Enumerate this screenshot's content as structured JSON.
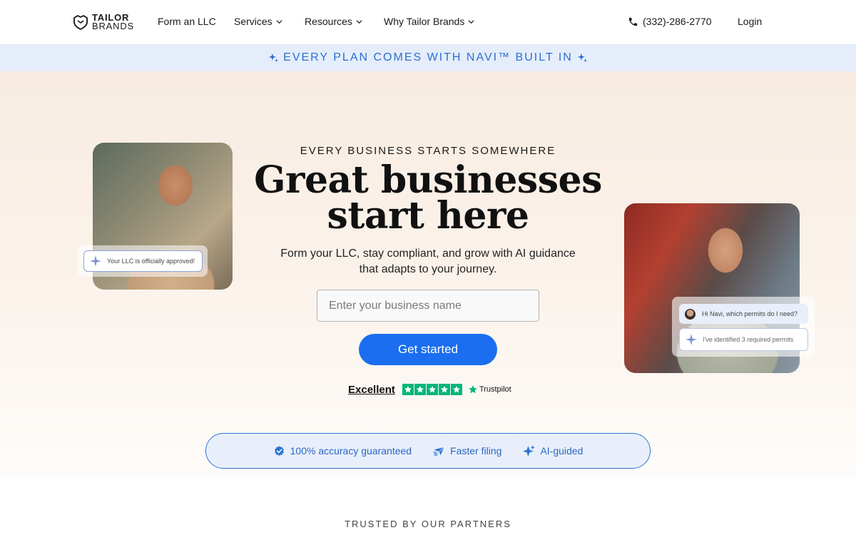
{
  "nav": {
    "logo_line1": "TAILOR",
    "logo_line2": "BRANDS",
    "links": [
      {
        "label": "Form an LLC",
        "has_dropdown": false
      },
      {
        "label": "Services",
        "has_dropdown": true
      },
      {
        "label": "Resources",
        "has_dropdown": true
      },
      {
        "label": "Why Tailor Brands",
        "has_dropdown": true
      }
    ],
    "phone": "(332)-286-2770",
    "login": "Login"
  },
  "banner": {
    "text": "EVERY PLAN COMES WITH NAVI™ BUILT IN",
    "icon": "sparkle-icon",
    "color": "#2b6fd0"
  },
  "hero": {
    "eyebrow": "EVERY BUSINESS STARTS SOMEWHERE",
    "headline_line1": "Great businesses",
    "headline_line2": "start here",
    "subheadline_line1": "Form your LLC, stay compliant, and grow with AI guidance",
    "subheadline_line2": "that adapts to your journey.",
    "input_placeholder": "Enter your business name",
    "input_value": "",
    "cta_label": "Get started",
    "cta_color": "#1a6eef",
    "llc_chip": "Your LLC is officially approved!",
    "chat_question": "Hi Navi, which permits do I need?",
    "chat_answer": "I've identified 3 required permits"
  },
  "trustpilot": {
    "rating_label": "Excellent",
    "stars": 5,
    "brand": "Trustpilot",
    "color": "#00b67a"
  },
  "features": [
    {
      "label": "100% accuracy guaranteed",
      "icon": "check-badge-icon"
    },
    {
      "label": "Faster filing",
      "icon": "fast-plane-icon"
    },
    {
      "label": "AI-guided",
      "icon": "sparkle-icon"
    }
  ],
  "trusted": {
    "label": "TRUSTED BY OUR PARTNERS"
  }
}
